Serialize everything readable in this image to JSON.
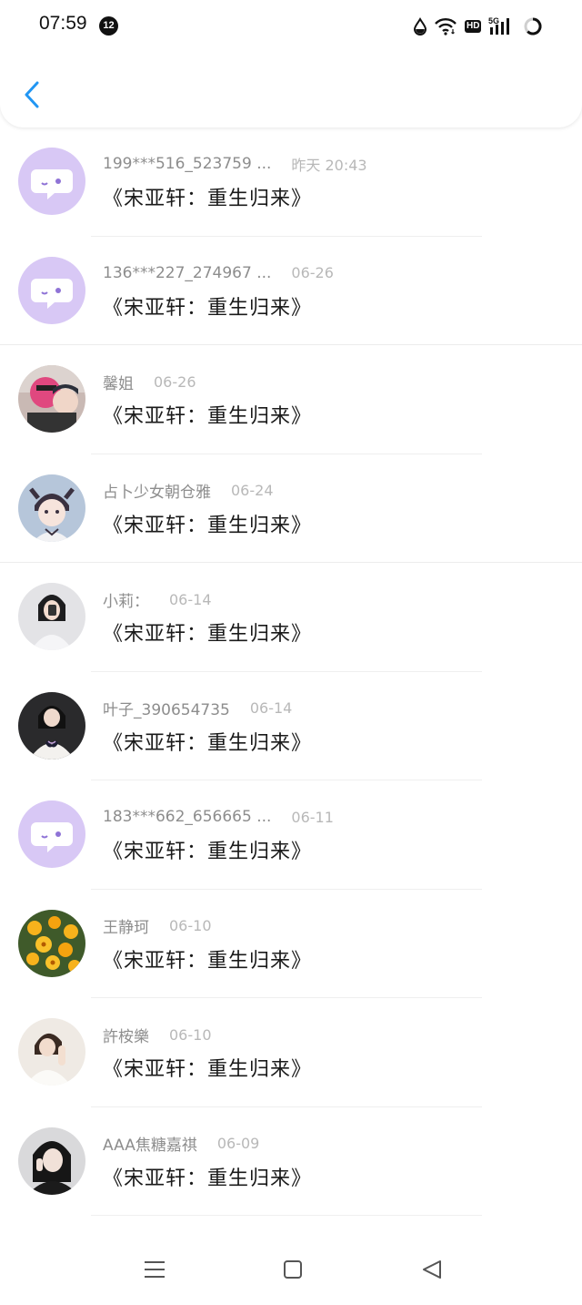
{
  "status_bar": {
    "time": "07:59",
    "notification_count": "12",
    "hd_label": "HD",
    "network_label": "5G"
  },
  "header": {
    "back_icon": "chevron-left-icon"
  },
  "items": [
    {
      "name": "199***516_523759 ...",
      "date": "昨天 20:43",
      "title": "《宋亚轩：重生归来》",
      "avatar": "default-chat-avatar"
    },
    {
      "name": "136***227_274967 ...",
      "date": "06-26",
      "title": "《宋亚轩：重生归来》",
      "avatar": "default-chat-avatar"
    },
    {
      "name": "馨姐",
      "date": "06-26",
      "title": "《宋亚轩：重生归来》",
      "avatar": "user-photo-avatar"
    },
    {
      "name": "占卜少女朝仓雅",
      "date": "06-24",
      "title": "《宋亚轩：重生归来》",
      "avatar": "anime-avatar"
    },
    {
      "name": "小莉：",
      "date": "06-14",
      "title": "《宋亚轩：重生归来》",
      "avatar": "user-photo-avatar"
    },
    {
      "name": "叶子_390654735",
      "date": "06-14",
      "title": "《宋亚轩：重生归来》",
      "avatar": "user-photo-avatar"
    },
    {
      "name": "183***662_656665 ...",
      "date": "06-11",
      "title": "《宋亚轩：重生归来》",
      "avatar": "default-chat-avatar"
    },
    {
      "name": "王静珂",
      "date": "06-10",
      "title": "《宋亚轩：重生归来》",
      "avatar": "flower-avatar"
    },
    {
      "name": "許桉樂",
      "date": "06-10",
      "title": "《宋亚轩：重生归来》",
      "avatar": "user-photo-avatar"
    },
    {
      "name": "AAA焦糖嘉祺",
      "date": "06-09",
      "title": "《宋亚轩：重生归来》",
      "avatar": "user-photo-avatar"
    }
  ],
  "nav_bar": {
    "menu_icon": "menu-icon",
    "home_icon": "home-square-icon",
    "back_icon": "back-triangle-icon"
  },
  "colors": {
    "accent": "#2196f3",
    "default_avatar_bg": "#d8c8f5",
    "default_avatar_accent": "#8f73d6"
  }
}
